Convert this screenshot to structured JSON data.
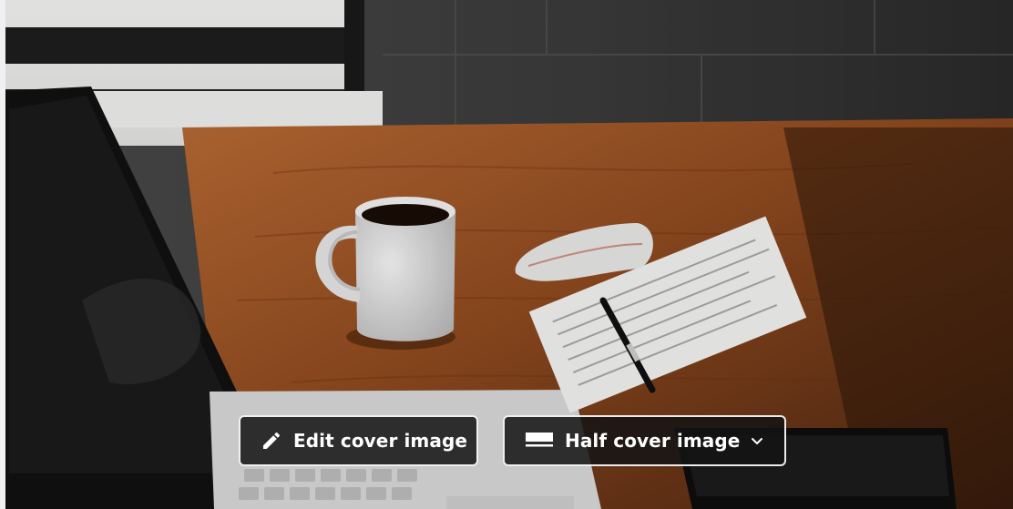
{
  "cover": {
    "background_icon": "desk-photo-coffee-laptop-notepad",
    "edit_button": {
      "label": "Edit cover image",
      "icon": "pencil-icon"
    },
    "layout_button": {
      "label": "Half cover image",
      "icon": "half-cover-layout-icon",
      "dropdown_icon": "chevron-down-icon"
    }
  },
  "colors": {
    "button_bg": "#141414",
    "button_border": "#ffffff",
    "wood": "#9a4a1c",
    "wall": "#3d3d3d"
  }
}
